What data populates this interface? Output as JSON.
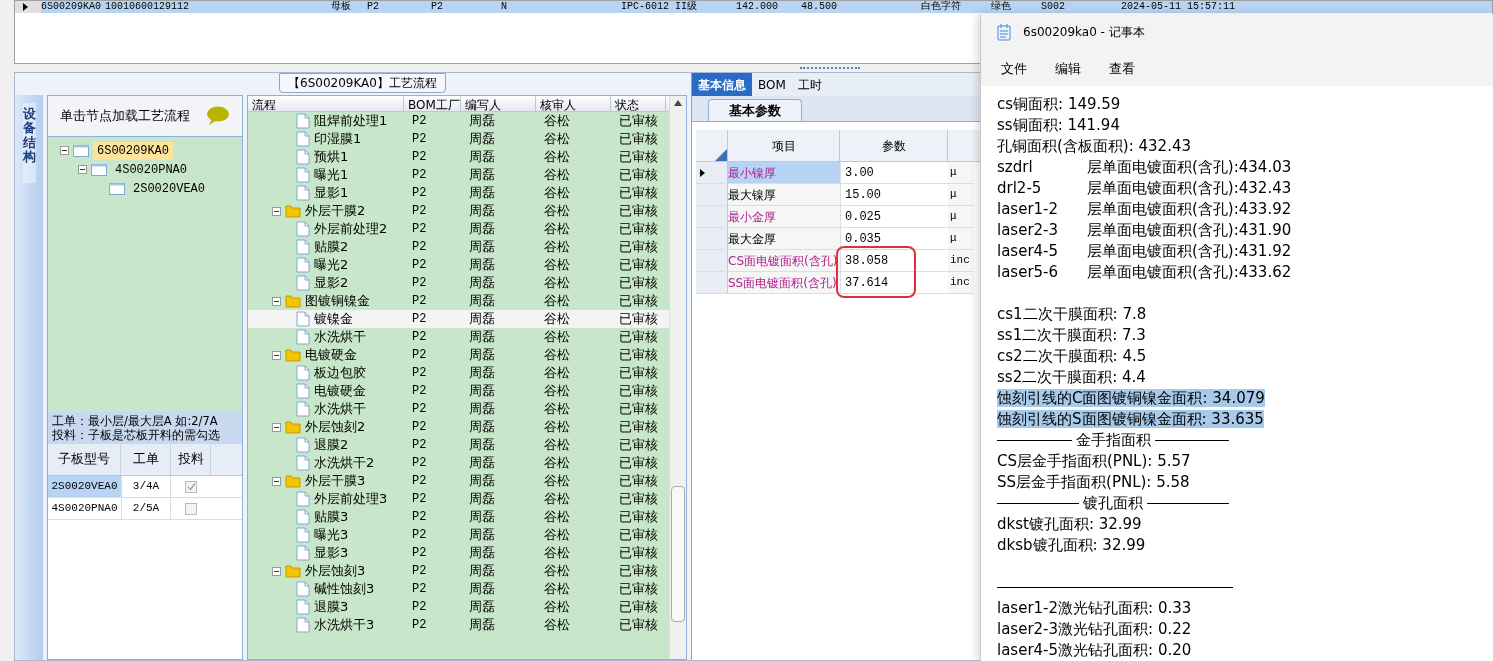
{
  "top_grid": {
    "rows": [
      {
        "selected": true,
        "cells": [
          "6S00209KA0",
          "10010600129112",
          "母板",
          "P2",
          "P2",
          "N",
          "IPC-6012 II级",
          "142.000",
          "48.500",
          "白色字符",
          "绿色",
          "S002",
          "2024-05-11 15:57:11"
        ]
      }
    ]
  },
  "flow_panel": {
    "title": "【6S00209KA0】工艺流程"
  },
  "side_tab": {
    "label": "设备结构"
  },
  "structure": {
    "hint": "单击节点加载工艺流程",
    "tree": [
      {
        "label": "6S00209KA0",
        "selected": true,
        "expanded": true,
        "children": [
          {
            "label": "4S0020PNA0",
            "selected": false,
            "expanded": true,
            "children": [
              {
                "label": "2S0020VEA0",
                "selected": false
              }
            ]
          }
        ]
      }
    ],
    "notes": [
      "工单：最小层/最大层A 如:2/7A",
      "投料：子板是芯板开料的需勾选"
    ],
    "columns": [
      "子板型号",
      "工单",
      "投料"
    ],
    "rows": [
      {
        "model": "2S0020VEA0",
        "order": "3/4A",
        "checked": true,
        "selected": true
      },
      {
        "model": "4S0020PNA0",
        "order": "2/5A",
        "checked": false,
        "selected": false
      }
    ]
  },
  "process": {
    "columns": [
      "流程",
      "BOM工厂",
      "编写人",
      "核审人",
      "状态"
    ],
    "tree": [
      {
        "children": [
          {
            "name": "阻焊前处理1",
            "bom": "P2",
            "writer": "周磊",
            "reviewer": "谷松",
            "status": "已审核",
            "selected": false
          },
          {
            "name": "印湿膜1",
            "bom": "P2",
            "writer": "周磊",
            "reviewer": "谷松",
            "status": "已审核",
            "selected": false
          },
          {
            "name": "预烘1",
            "bom": "P2",
            "writer": "周磊",
            "reviewer": "谷松",
            "status": "已审核",
            "selected": false
          },
          {
            "name": "曝光1",
            "bom": "P2",
            "writer": "周磊",
            "reviewer": "谷松",
            "status": "已审核",
            "selected": false
          },
          {
            "name": "显影1",
            "bom": "P2",
            "writer": "周磊",
            "reviewer": "谷松",
            "status": "已审核",
            "selected": false
          }
        ]
      },
      {
        "name": "外层干膜2",
        "bom": "P2",
        "writer": "周磊",
        "reviewer": "谷松",
        "status": "已审核",
        "selected": false,
        "expanded": true,
        "children": [
          {
            "name": "外层前处理2",
            "bom": "P2",
            "writer": "周磊",
            "reviewer": "谷松",
            "status": "已审核",
            "selected": false
          },
          {
            "name": "贴膜2",
            "bom": "P2",
            "writer": "周磊",
            "reviewer": "谷松",
            "status": "已审核",
            "selected": false
          },
          {
            "name": "曝光2",
            "bom": "P2",
            "writer": "周磊",
            "reviewer": "谷松",
            "status": "已审核",
            "selected": false
          },
          {
            "name": "显影2",
            "bom": "P2",
            "writer": "周磊",
            "reviewer": "谷松",
            "status": "已审核",
            "selected": false
          }
        ]
      },
      {
        "name": "图镀铜镍金",
        "bom": "P2",
        "writer": "周磊",
        "reviewer": "谷松",
        "status": "已审核",
        "selected": false,
        "expanded": true,
        "children": [
          {
            "name": "镀镍金",
            "bom": "P2",
            "writer": "周磊",
            "reviewer": "谷松",
            "status": "已审核",
            "selected": true
          },
          {
            "name": "水洗烘干",
            "bom": "P2",
            "writer": "周磊",
            "reviewer": "谷松",
            "status": "已审核",
            "selected": false
          }
        ]
      },
      {
        "name": "电镀硬金",
        "bom": "P2",
        "writer": "周磊",
        "reviewer": "谷松",
        "status": "已审核",
        "selected": false,
        "expanded": true,
        "children": [
          {
            "name": "板边包胶",
            "bom": "P2",
            "writer": "周磊",
            "reviewer": "谷松",
            "status": "已审核",
            "selected": false
          },
          {
            "name": "电镀硬金",
            "bom": "P2",
            "writer": "周磊",
            "reviewer": "谷松",
            "status": "已审核",
            "selected": false
          },
          {
            "name": "水洗烘干",
            "bom": "P2",
            "writer": "周磊",
            "reviewer": "谷松",
            "status": "已审核",
            "selected": false
          }
        ]
      },
      {
        "name": "外层蚀刻2",
        "bom": "P2",
        "writer": "周磊",
        "reviewer": "谷松",
        "status": "已审核",
        "selected": false,
        "expanded": true,
        "children": [
          {
            "name": "退膜2",
            "bom": "P2",
            "writer": "周磊",
            "reviewer": "谷松",
            "status": "已审核",
            "selected": false
          },
          {
            "name": "水洗烘干2",
            "bom": "P2",
            "writer": "周磊",
            "reviewer": "谷松",
            "status": "已审核",
            "selected": false
          }
        ]
      },
      {
        "name": "外层干膜3",
        "bom": "P2",
        "writer": "周磊",
        "reviewer": "谷松",
        "status": "已审核",
        "selected": false,
        "expanded": true,
        "children": [
          {
            "name": "外层前处理3",
            "bom": "P2",
            "writer": "周磊",
            "reviewer": "谷松",
            "status": "已审核",
            "selected": false
          },
          {
            "name": "贴膜3",
            "bom": "P2",
            "writer": "周磊",
            "reviewer": "谷松",
            "status": "已审核",
            "selected": false
          },
          {
            "name": "曝光3",
            "bom": "P2",
            "writer": "周磊",
            "reviewer": "谷松",
            "status": "已审核",
            "selected": false
          },
          {
            "name": "显影3",
            "bom": "P2",
            "writer": "周磊",
            "reviewer": "谷松",
            "status": "已审核",
            "selected": false
          }
        ]
      },
      {
        "name": "外层蚀刻3",
        "bom": "P2",
        "writer": "周磊",
        "reviewer": "谷松",
        "status": "已审核",
        "selected": false,
        "expanded": true,
        "children": [
          {
            "name": "碱性蚀刻3",
            "bom": "P2",
            "writer": "周磊",
            "reviewer": "谷松",
            "status": "已审核",
            "selected": false
          },
          {
            "name": "退膜3",
            "bom": "P2",
            "writer": "周磊",
            "reviewer": "谷松",
            "status": "已审核",
            "selected": false
          },
          {
            "name": "水洗烘干3",
            "bom": "P2",
            "writer": "周磊",
            "reviewer": "谷松",
            "status": "已审核",
            "selected": false
          }
        ]
      }
    ]
  },
  "info": {
    "tabs": [
      {
        "label": "基本信息",
        "selected": true
      },
      {
        "label": "BOM",
        "selected": false
      },
      {
        "label": "工时",
        "selected": false
      }
    ],
    "subtabs": [
      {
        "label": "基本参数",
        "selected": true
      }
    ],
    "columns": [
      "项目",
      "参数"
    ],
    "rows": [
      {
        "item": "最小镍厚",
        "value": "3.00",
        "unit": "μ",
        "emphasized": true,
        "selected": true,
        "circled": false
      },
      {
        "item": "最大镍厚",
        "value": "15.00",
        "unit": "μ",
        "emphasized": false,
        "selected": false,
        "circled": false
      },
      {
        "item": "最小金厚",
        "value": "0.025",
        "unit": "μ",
        "emphasized": true,
        "selected": false,
        "circled": false
      },
      {
        "item": "最大金厚",
        "value": "0.035",
        "unit": "μ",
        "emphasized": false,
        "selected": false,
        "circled": false
      },
      {
        "item": "CS面电镀面积(含孔)",
        "value": "38.058",
        "unit": "inc",
        "emphasized": true,
        "selected": false,
        "circled": true
      },
      {
        "item": "SS面电镀面积(含孔)",
        "value": "37.614",
        "unit": "inc",
        "emphasized": true,
        "selected": false,
        "circled": true
      }
    ]
  },
  "notepad": {
    "title": "6s00209ka0 - 记事本",
    "menu": [
      "文件",
      "编辑",
      "查看"
    ],
    "lines": [
      {
        "kind": "text",
        "text": "cs铜面积: 149.59",
        "selected": false
      },
      {
        "kind": "text",
        "text": "ss铜面积: 141.94",
        "selected": false
      },
      {
        "kind": "text",
        "text": "孔铜面积(含板面积): 432.43",
        "selected": false
      },
      {
        "kind": "pair",
        "label": "szdrl",
        "text": "层单面电镀面积(含孔):434.03",
        "selected": false
      },
      {
        "kind": "pair",
        "label": "drl2-5",
        "text": "层单面电镀面积(含孔):432.43",
        "selected": false
      },
      {
        "kind": "pair",
        "label": "laser1-2",
        "text": "层单面电镀面积(含孔):433.92",
        "selected": false
      },
      {
        "kind": "pair",
        "label": "laser2-3",
        "text": "层单面电镀面积(含孔):431.90",
        "selected": false
      },
      {
        "kind": "pair",
        "label": "laser4-5",
        "text": "层单面电镀面积(含孔):431.92",
        "selected": false
      },
      {
        "kind": "pair",
        "label": "laser5-6",
        "text": "层单面电镀面积(含孔):433.62",
        "selected": false
      },
      {
        "kind": "blank"
      },
      {
        "kind": "text",
        "text": "cs1二次干膜面积: 7.8",
        "selected": false
      },
      {
        "kind": "text",
        "text": "ss1二次干膜面积: 7.3",
        "selected": false
      },
      {
        "kind": "text",
        "text": "cs2二次干膜面积: 4.5",
        "selected": false
      },
      {
        "kind": "text",
        "text": "ss2二次干膜面积: 4.4",
        "selected": false
      },
      {
        "kind": "text",
        "text": "蚀刻引线的C面图镀铜镍金面积: 34.079",
        "selected": true
      },
      {
        "kind": "text",
        "text": "蚀刻引线的S面图镀铜镍金面积: 33.635",
        "selected": true
      },
      {
        "kind": "heading",
        "text": "金手指面积"
      },
      {
        "kind": "text",
        "text": "CS层金手指面积(PNL): 5.57",
        "selected": false
      },
      {
        "kind": "text",
        "text": "SS层金手指面积(PNL): 5.58",
        "selected": false
      },
      {
        "kind": "heading",
        "text": "镀孔面积"
      },
      {
        "kind": "text",
        "text": "dkst镀孔面积: 32.99",
        "selected": false
      },
      {
        "kind": "text",
        "text": "dksb镀孔面积: 32.99",
        "selected": false
      },
      {
        "kind": "blank"
      },
      {
        "kind": "rule"
      },
      {
        "kind": "text",
        "text": "laser1-2激光钻孔面积: 0.33",
        "selected": false
      },
      {
        "kind": "text",
        "text": "laser2-3激光钻孔面积: 0.22",
        "selected": false
      },
      {
        "kind": "text",
        "text": "laser4-5激光钻孔面积: 0.20",
        "selected": false
      }
    ]
  }
}
